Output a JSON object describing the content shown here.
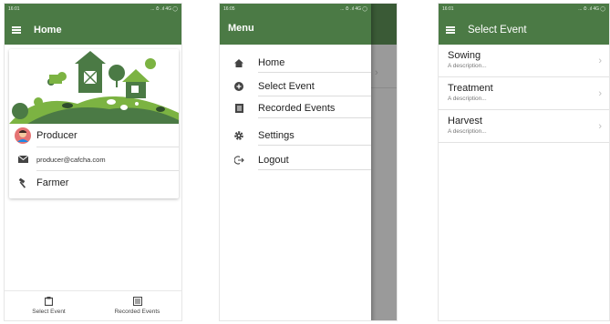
{
  "screens": {
    "home": {
      "status_time": "16:01",
      "status_icons": "... ⏱ .ıl 4G ◯",
      "title": "Home",
      "profile": {
        "name": "Producer",
        "email": "producer@cafcha.com",
        "role": "Farmer"
      },
      "bottom_nav": [
        {
          "label": "Select Event",
          "icon": "clipboard-icon"
        },
        {
          "label": "Recorded Events",
          "icon": "list-icon"
        }
      ]
    },
    "menu": {
      "status_time": "16:05",
      "status_icons": "... ⏱ .ıl 4G ◯",
      "title": "Menu",
      "behind_chevron": "›",
      "items": [
        {
          "label": "Home",
          "icon": "home-icon"
        },
        {
          "label": "Select Event",
          "icon": "add-circle-icon"
        },
        {
          "label": "Recorded Events",
          "icon": "list-icon"
        },
        {
          "label": "Settings",
          "icon": "gear-icon"
        },
        {
          "label": "Logout",
          "icon": "logout-icon"
        }
      ]
    },
    "select_event": {
      "status_time": "16:01",
      "status_icons": "... ⏱ .ıl 4G ◯",
      "title": "Select Event",
      "events": [
        {
          "name": "Sowing",
          "description": "A description..."
        },
        {
          "name": "Treatment",
          "description": "A description..."
        },
        {
          "name": "Harvest",
          "description": "A description..."
        }
      ],
      "chevron": "›"
    }
  },
  "colors": {
    "primary": "#4b7a45",
    "primary_dark": "#3a5a36",
    "accent_green": "#7cb342"
  }
}
